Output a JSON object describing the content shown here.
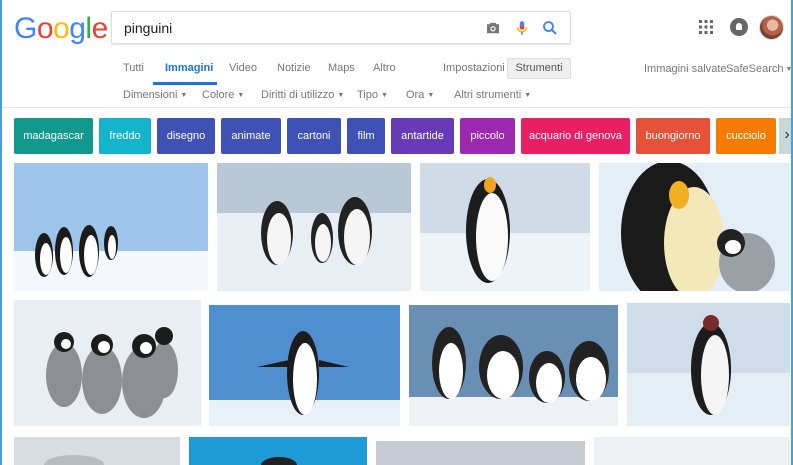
{
  "logo": {
    "letters": [
      "G",
      "o",
      "o",
      "g",
      "l",
      "e"
    ],
    "colors": [
      "#4285f4",
      "#ea4335",
      "#fbbc05",
      "#4285f4",
      "#34a853",
      "#ea4335"
    ]
  },
  "search": {
    "value": "pinguini",
    "placeholder": ""
  },
  "tabs": [
    {
      "label": "Tutti"
    },
    {
      "label": "Immagini",
      "active": true
    },
    {
      "label": "Video"
    },
    {
      "label": "Notizie"
    },
    {
      "label": "Maps"
    },
    {
      "label": "Altro"
    }
  ],
  "settings_label": "Impostazioni",
  "tools_button": "Strumenti",
  "saved_images": "Immagini salvate",
  "safesearch": "SafeSearch",
  "tools": [
    {
      "label": "Dimensioni"
    },
    {
      "label": "Colore"
    },
    {
      "label": "Diritti di utilizzo"
    },
    {
      "label": "Tipo"
    },
    {
      "label": "Ora"
    },
    {
      "label": "Altri strumenti"
    }
  ],
  "chips": [
    {
      "label": "madagascar",
      "color": "#11998e"
    },
    {
      "label": "freddo",
      "color": "#12b5cb"
    },
    {
      "label": "disegno",
      "color": "#3f51b5"
    },
    {
      "label": "animate",
      "color": "#3f51b5"
    },
    {
      "label": "cartoni",
      "color": "#3f51b5"
    },
    {
      "label": "film",
      "color": "#3f51b5"
    },
    {
      "label": "antartide",
      "color": "#673ab7"
    },
    {
      "label": "piccolo",
      "color": "#9c27b0"
    },
    {
      "label": "acquario di genova",
      "color": "#e91e63"
    },
    {
      "label": "buongiorno",
      "color": "#e65138"
    },
    {
      "label": "cucciolo",
      "color": "#f57c00"
    }
  ],
  "icons": {
    "camera": "camera-icon",
    "mic": "microphone-icon",
    "search": "search-icon",
    "apps": "apps-grid-icon",
    "notifications": "notifications-icon",
    "next": "chevron-right-icon"
  }
}
